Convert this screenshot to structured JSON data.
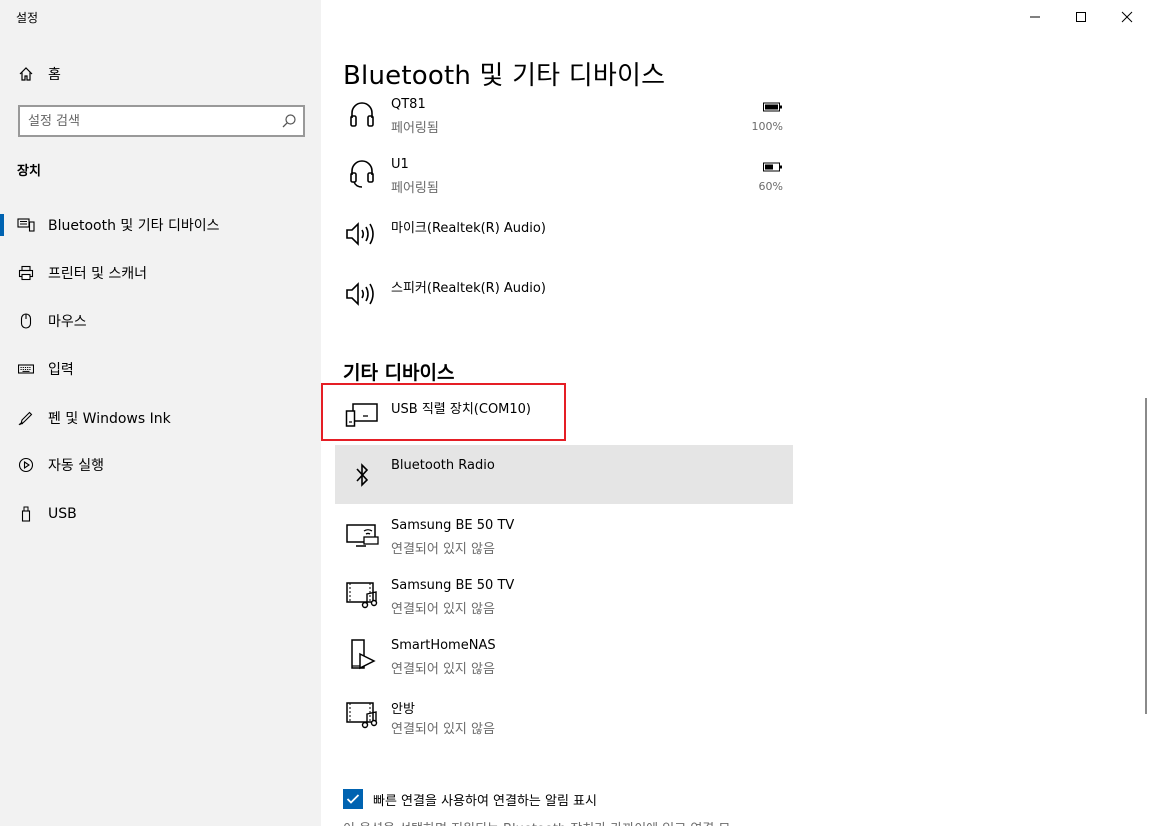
{
  "window": {
    "title": "설정",
    "controls": [
      "minimize",
      "maximize",
      "close"
    ]
  },
  "sidebar": {
    "home_label": "홈",
    "search": {
      "placeholder": "설정 검색",
      "value": ""
    },
    "section_label": "장치",
    "items": [
      {
        "label": "Bluetooth 및 기타 디바이스",
        "icon": "bluetooth-devices-icon",
        "active": true
      },
      {
        "label": "프린터 및 스캐너",
        "icon": "printer-icon",
        "active": false
      },
      {
        "label": "마우스",
        "icon": "mouse-icon",
        "active": false
      },
      {
        "label": "입력",
        "icon": "keyboard-icon",
        "active": false
      },
      {
        "label": "펜 및 Windows Ink",
        "icon": "pen-icon",
        "active": false
      },
      {
        "label": "자동 실행",
        "icon": "autoplay-icon",
        "active": false
      },
      {
        "label": "USB",
        "icon": "usb-icon",
        "active": false
      }
    ]
  },
  "main": {
    "title": "Bluetooth 및 기타 디바이스",
    "audio_devices": [
      {
        "name": "QT81",
        "status": "페어링됨",
        "battery": "100%",
        "icon": "headphones-icon"
      },
      {
        "name": "U1",
        "status": "페어링됨",
        "battery": "60%",
        "icon": "headset-icon"
      },
      {
        "name": "마이크(Realtek(R) Audio)",
        "status": "",
        "icon": "speaker-icon"
      },
      {
        "name": "스피커(Realtek(R) Audio)",
        "status": "",
        "icon": "speaker-icon"
      }
    ],
    "other_header": "기타 디바이스",
    "other_devices": [
      {
        "name": "USB 직렬 장치(COM10)",
        "status": "",
        "icon": "usb-serial-device-icon"
      },
      {
        "name": "Bluetooth Radio",
        "status": "",
        "icon": "bluetooth-icon"
      },
      {
        "name": "Samsung BE 50 TV",
        "status": "연결되어 있지 않음",
        "icon": "tv-wireless-icon"
      },
      {
        "name": "Samsung BE 50 TV",
        "status": "연결되어 있지 않음",
        "icon": "media-device-icon"
      },
      {
        "name": "SmartHomeNAS",
        "status": "연결되어 있지 않음",
        "icon": "media-server-icon"
      },
      {
        "name": "안방",
        "status": "연결되어 있지 않음",
        "icon": "media-device-icon"
      }
    ],
    "swift_pair": {
      "checked": true,
      "label": "빠른 연결을 사용하여 연결하는 알림 표시",
      "description_cut": "이 옵션을 선택하면 지원되는 Bluetooth 장치가 가까이에 있고 연결 모"
    }
  },
  "colors": {
    "accent": "#0063b1",
    "highlight_box": "#e51e25",
    "sidebar_bg": "#f2f2f2",
    "selected_row_bg": "#e5e5e5"
  }
}
